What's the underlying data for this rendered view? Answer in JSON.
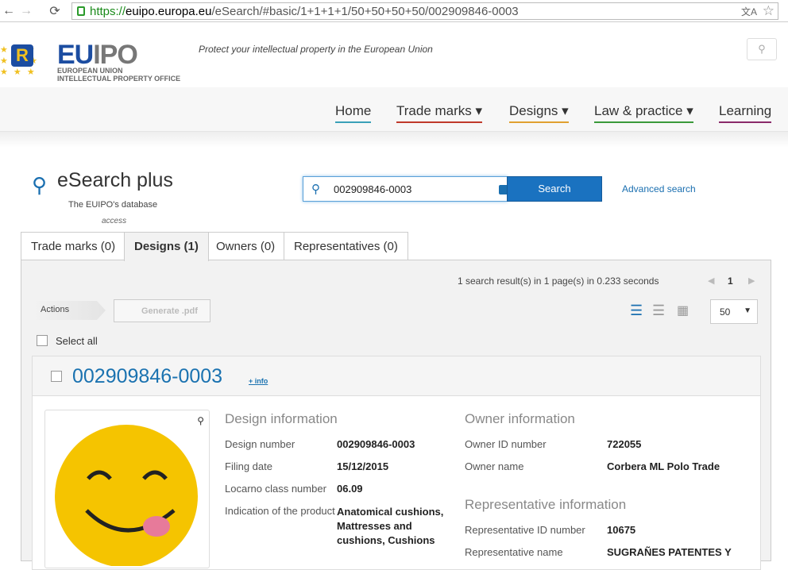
{
  "browser": {
    "url_scheme": "https://",
    "url_host": "euipo.europa.eu",
    "url_path": "/eSearch/#basic/1+1+1+1/50+50+50+50/002909846-0003"
  },
  "header": {
    "logo_text_1": "EU",
    "logo_text_2": "IPO",
    "logo_sub_1": "EUROPEAN UNION",
    "logo_sub_2": "INTELLECTUAL PROPERTY OFFICE",
    "tagline": "Protect your intellectual property in the European Union"
  },
  "nav": {
    "items": [
      {
        "label": "Home",
        "color": "#3aa0b8"
      },
      {
        "label": "Trade marks",
        "color": "#c0392b"
      },
      {
        "label": "Designs",
        "color": "#e0a030"
      },
      {
        "label": "Law & practice",
        "color": "#3a9a3a"
      },
      {
        "label": "Learning",
        "color": "#8a2a6a"
      }
    ]
  },
  "esearch": {
    "title": "eSearch plus",
    "subtitle": "The EUIPO's database",
    "subtitle2": "access",
    "search_value": "002909846-0003",
    "search_button": "Search",
    "advanced": "Advanced search"
  },
  "tabs": [
    {
      "label": "Trade marks (0)"
    },
    {
      "label": "Designs (1)"
    },
    {
      "label": "Owners (0)"
    },
    {
      "label": "Representatives (0)"
    }
  ],
  "results": {
    "summary": "1 search result(s) in 1 page(s) in 0.233 seconds",
    "page": "1",
    "actions": "Actions",
    "generate_pdf": "Generate .pdf",
    "per_page": "50",
    "select_all": "Select all"
  },
  "record": {
    "number": "002909846-0003",
    "more_info": "+ info",
    "design_title": "Design information",
    "design": [
      {
        "label": "Design number",
        "value": "002909846-0003"
      },
      {
        "label": "Filing date",
        "value": "15/12/2015"
      },
      {
        "label": "Locarno class number",
        "value": "06.09"
      },
      {
        "label": "Indication of the product",
        "value": "Anatomical cushions, Mattresses and cushions, Cushions"
      }
    ],
    "owner_title": "Owner information",
    "owner": [
      {
        "label": "Owner ID number",
        "value": "722055"
      },
      {
        "label": "Owner name",
        "value": "Corbera ML Polo Trade"
      }
    ],
    "rep_title": "Representative information",
    "rep": [
      {
        "label": "Representative ID number",
        "value": "10675"
      },
      {
        "label": "Representative name",
        "value": "SUGRAÑES PATENTES Y"
      }
    ]
  }
}
